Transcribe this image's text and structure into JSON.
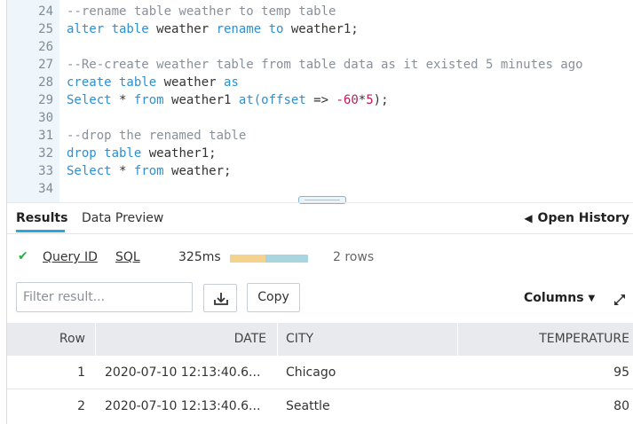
{
  "editor": {
    "lines": [
      {
        "n": "24",
        "segs": [
          {
            "t": "--rename table weather to temp table",
            "c": "c"
          }
        ]
      },
      {
        "n": "25",
        "segs": [
          {
            "t": "alter table",
            "c": "k"
          },
          {
            "t": " weather ",
            "c": "p"
          },
          {
            "t": "rename to",
            "c": "k"
          },
          {
            "t": " weather1;",
            "c": "p"
          }
        ]
      },
      {
        "n": "26",
        "segs": []
      },
      {
        "n": "27",
        "segs": [
          {
            "t": "--Re-create weather table from table data as it existed 5 minutes ago",
            "c": "c"
          }
        ]
      },
      {
        "n": "28",
        "segs": [
          {
            "t": "create table",
            "c": "k"
          },
          {
            "t": " weather ",
            "c": "p"
          },
          {
            "t": "as",
            "c": "k"
          }
        ]
      },
      {
        "n": "29",
        "segs": [
          {
            "t": "Select",
            "c": "k"
          },
          {
            "t": " * ",
            "c": "p"
          },
          {
            "t": "from",
            "c": "k"
          },
          {
            "t": " weather1 ",
            "c": "p"
          },
          {
            "t": "at(offset",
            "c": "k"
          },
          {
            "t": " => ",
            "c": "p"
          },
          {
            "t": "-60",
            "c": "n"
          },
          {
            "t": "*",
            "c": "p"
          },
          {
            "t": "5",
            "c": "n"
          },
          {
            "t": ");",
            "c": "p"
          }
        ]
      },
      {
        "n": "30",
        "segs": []
      },
      {
        "n": "31",
        "segs": [
          {
            "t": "--drop the renamed table",
            "c": "c"
          }
        ]
      },
      {
        "n": "32",
        "segs": [
          {
            "t": "drop table",
            "c": "k"
          },
          {
            "t": " weather1;",
            "c": "p"
          }
        ]
      },
      {
        "n": "33",
        "segs": [
          {
            "t": "Select",
            "c": "k"
          },
          {
            "t": " * ",
            "c": "p"
          },
          {
            "t": "from",
            "c": "k"
          },
          {
            "t": " weather;",
            "c": "p"
          }
        ]
      },
      {
        "n": "34",
        "segs": []
      }
    ]
  },
  "tabs": {
    "results": "Results",
    "data_preview": "Data Preview",
    "open_history": "Open History",
    "open_history_icon": "arrow-left-icon"
  },
  "query": {
    "status_icon": "check-icon",
    "query_id_label": "Query ID",
    "sql_label": "SQL",
    "duration": "325ms",
    "duration_split": 0.45,
    "rows": "2 rows"
  },
  "toolbar": {
    "filter_placeholder": "Filter result...",
    "download_icon": "download-icon",
    "copy_label": "Copy",
    "columns_label": "Columns",
    "expand_icon": "expand-icon"
  },
  "table": {
    "headers": {
      "row": "Row",
      "date": "DATE",
      "city": "CITY",
      "temperature": "TEMPERATURE"
    },
    "rows": [
      {
        "row": "1",
        "date": "2020-07-10 12:13:40.6...",
        "city": "Chicago",
        "temperature": "95"
      },
      {
        "row": "2",
        "date": "2020-07-10 12:13:40.6...",
        "city": "Seattle",
        "temperature": "80"
      }
    ]
  },
  "colors": {
    "accent": "#29a8e0",
    "success": "#2eaa4a",
    "keyword": "#2f8fcf",
    "comment": "#8a9099",
    "number": "#c2185b",
    "bar_compile": "#f3d38d",
    "bar_execute": "#a8d5e0"
  }
}
